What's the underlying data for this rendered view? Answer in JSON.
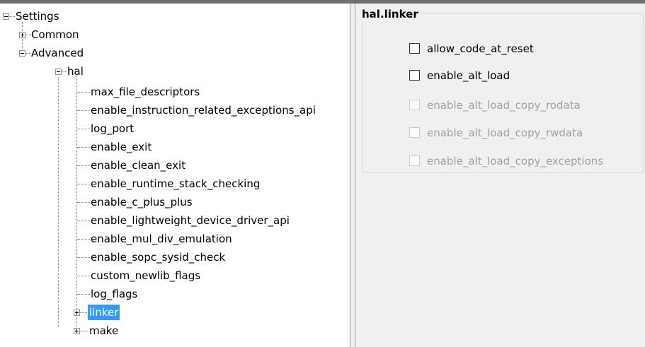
{
  "tree": {
    "root": "Settings",
    "common": "Common",
    "advanced": "Advanced",
    "hal": "hal",
    "hal_items": [
      "max_file_descriptors",
      "enable_instruction_related_exceptions_api",
      "log_port",
      "enable_exit",
      "enable_clean_exit",
      "enable_runtime_stack_checking",
      "enable_c_plus_plus",
      "enable_lightweight_device_driver_api",
      "enable_mul_div_emulation",
      "enable_sopc_sysid_check",
      "custom_newlib_flags",
      "log_flags"
    ],
    "linker": "linker",
    "make": "make"
  },
  "panel": {
    "title": "hal.linker",
    "options": [
      {
        "label": "allow_code_at_reset",
        "checked": false,
        "enabled": true
      },
      {
        "label": "enable_alt_load",
        "checked": false,
        "enabled": true
      },
      {
        "label": "enable_alt_load_copy_rodata",
        "checked": false,
        "enabled": false
      },
      {
        "label": "enable_alt_load_copy_rwdata",
        "checked": false,
        "enabled": false
      },
      {
        "label": "enable_alt_load_copy_exceptions",
        "checked": false,
        "enabled": false
      }
    ]
  },
  "colors": {
    "selection": "#3399ff",
    "panel_bg": "#f0f0f0",
    "disabled_text": "#a0a0a0"
  }
}
